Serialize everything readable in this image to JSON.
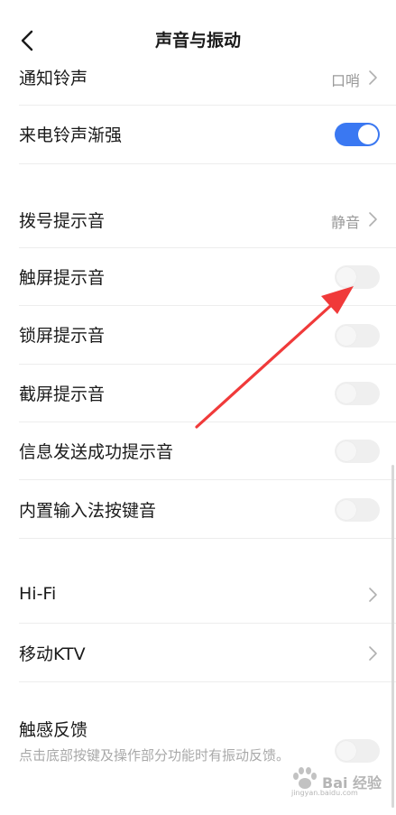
{
  "header": {
    "title": "声音与振动"
  },
  "settings": {
    "notification_ringtone": {
      "label": "通知铃声",
      "value": "口哨"
    },
    "incoming_ring_crescendo": {
      "label": "来电铃声渐强",
      "enabled": true
    },
    "dial_tone": {
      "label": "拨号提示音",
      "value": "静音"
    },
    "touch_sound": {
      "label": "触屏提示音",
      "enabled": false
    },
    "lock_sound": {
      "label": "锁屏提示音",
      "enabled": false
    },
    "screenshot_sound": {
      "label": "截屏提示音",
      "enabled": false
    },
    "message_sent_sound": {
      "label": "信息发送成功提示音",
      "enabled": false
    },
    "keyboard_sound": {
      "label": "内置输入法按键音",
      "enabled": false
    },
    "hifi": {
      "label": "Hi-Fi"
    },
    "mobile_ktv": {
      "label": "移动KTV"
    },
    "haptic_feedback": {
      "label": "触感反馈",
      "description": "点击底部按键及操作部分功能时有振动反馈。",
      "enabled": false
    }
  },
  "watermark": {
    "text": "Bai 经验",
    "url": "jingyan.baidu.com"
  },
  "colors": {
    "accent": "#3a78f2",
    "annotation_arrow": "#f03a3a"
  }
}
